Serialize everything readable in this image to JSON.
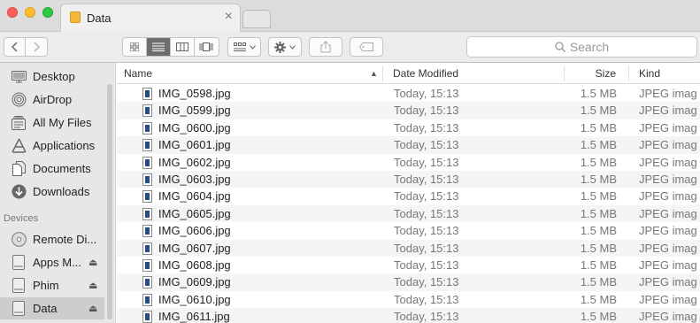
{
  "window": {
    "tab_title": "Data",
    "tab_close": "×"
  },
  "toolbar": {
    "search_placeholder": "Search",
    "back_icon": "chevron-left-icon",
    "forward_icon": "chevron-right-icon"
  },
  "sidebar": {
    "favorites": [
      {
        "label": "Desktop",
        "icon": "desktop-icon"
      },
      {
        "label": "AirDrop",
        "icon": "airdrop-icon"
      },
      {
        "label": "All My Files",
        "icon": "all-files-icon"
      },
      {
        "label": "Applications",
        "icon": "applications-icon"
      },
      {
        "label": "Documents",
        "icon": "documents-icon"
      },
      {
        "label": "Downloads",
        "icon": "downloads-icon"
      }
    ],
    "devices_header": "Devices",
    "devices": [
      {
        "label": "Remote Di...",
        "icon": "disc-icon",
        "eject": false
      },
      {
        "label": "Apps M...",
        "icon": "drive-icon",
        "eject": true
      },
      {
        "label": "Phim",
        "icon": "drive-icon",
        "eject": true
      },
      {
        "label": "Data",
        "icon": "drive-icon",
        "eject": true,
        "selected": true
      }
    ]
  },
  "list": {
    "columns": {
      "name": "Name",
      "date": "Date Modified",
      "size": "Size",
      "kind": "Kind"
    },
    "rows": [
      {
        "name": "IMG_0598.jpg",
        "date": "Today, 15:13",
        "size": "1.5 MB",
        "kind": "JPEG imag"
      },
      {
        "name": "IMG_0599.jpg",
        "date": "Today, 15:13",
        "size": "1.5 MB",
        "kind": "JPEG imag"
      },
      {
        "name": "IMG_0600.jpg",
        "date": "Today, 15:13",
        "size": "1.5 MB",
        "kind": "JPEG imag"
      },
      {
        "name": "IMG_0601.jpg",
        "date": "Today, 15:13",
        "size": "1.5 MB",
        "kind": "JPEG imag"
      },
      {
        "name": "IMG_0602.jpg",
        "date": "Today, 15:13",
        "size": "1.5 MB",
        "kind": "JPEG imag"
      },
      {
        "name": "IMG_0603.jpg",
        "date": "Today, 15:13",
        "size": "1.5 MB",
        "kind": "JPEG imag"
      },
      {
        "name": "IMG_0604.jpg",
        "date": "Today, 15:13",
        "size": "1.5 MB",
        "kind": "JPEG imag"
      },
      {
        "name": "IMG_0605.jpg",
        "date": "Today, 15:13",
        "size": "1.5 MB",
        "kind": "JPEG imag"
      },
      {
        "name": "IMG_0606.jpg",
        "date": "Today, 15:13",
        "size": "1.5 MB",
        "kind": "JPEG imag"
      },
      {
        "name": "IMG_0607.jpg",
        "date": "Today, 15:13",
        "size": "1.5 MB",
        "kind": "JPEG imag"
      },
      {
        "name": "IMG_0608.jpg",
        "date": "Today, 15:13",
        "size": "1.5 MB",
        "kind": "JPEG imag"
      },
      {
        "name": "IMG_0609.jpg",
        "date": "Today, 15:13",
        "size": "1.5 MB",
        "kind": "JPEG imag"
      },
      {
        "name": "IMG_0610.jpg",
        "date": "Today, 15:13",
        "size": "1.5 MB",
        "kind": "JPEG imag"
      },
      {
        "name": "IMG_0611.jpg",
        "date": "Today, 15:13",
        "size": "1.5 MB",
        "kind": "JPEG imag"
      }
    ]
  }
}
